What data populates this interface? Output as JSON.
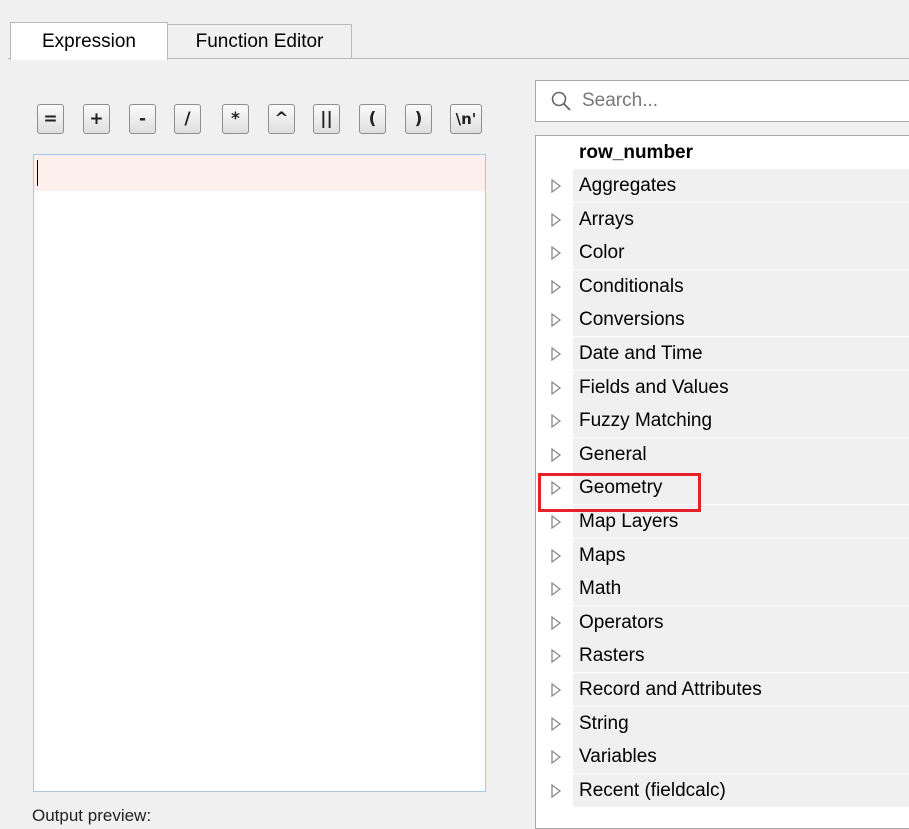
{
  "tabs": [
    {
      "label": "Expression",
      "active": true
    },
    {
      "label": "Function Editor",
      "active": false
    }
  ],
  "operators": [
    "=",
    "+",
    "-",
    "/",
    "*",
    "^",
    "||",
    "(",
    ")",
    "\\n'"
  ],
  "editor": {
    "text": "",
    "output_preview_label": "Output preview:"
  },
  "search": {
    "placeholder": "Search..."
  },
  "tree": {
    "header": "row_number",
    "items": [
      "Aggregates",
      "Arrays",
      "Color",
      "Conditionals",
      "Conversions",
      "Date and Time",
      "Fields and Values",
      "Fuzzy Matching",
      "General",
      "Geometry",
      "Map Layers",
      "Maps",
      "Math",
      "Operators",
      "Rasters",
      "Record and Attributes",
      "String",
      "Variables",
      "Recent (fieldcalc)"
    ],
    "highlighted": "Geometry"
  },
  "colors": {
    "highlight": "#e8202a",
    "editor_border": "#a9c7e3"
  }
}
